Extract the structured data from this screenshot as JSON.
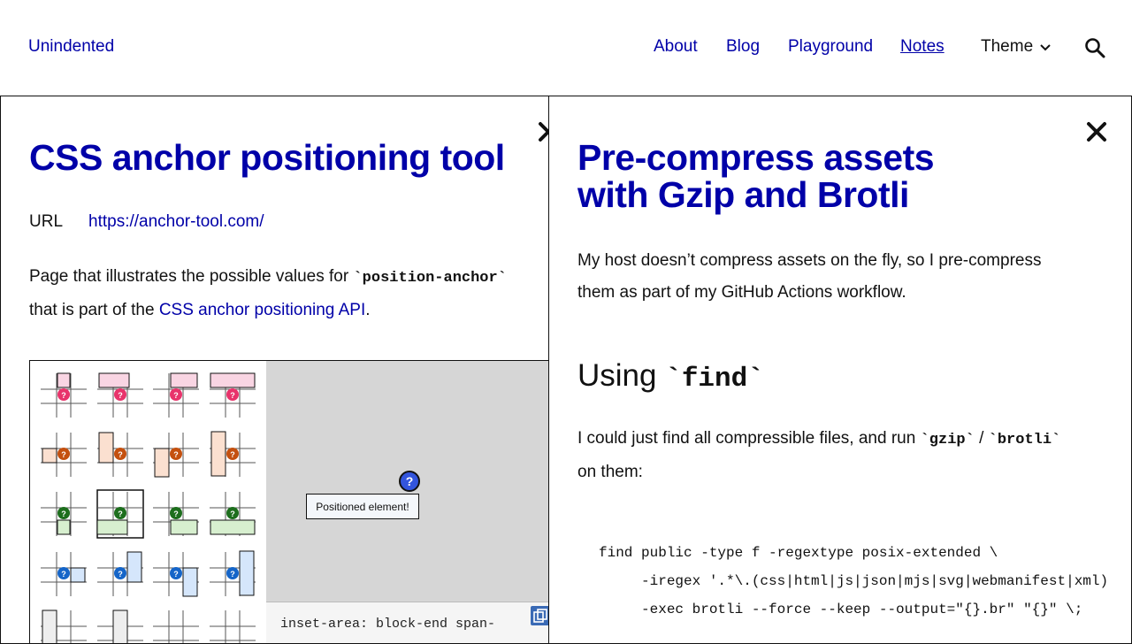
{
  "header": {
    "logo": "Unindented",
    "nav": [
      {
        "label": "About"
      },
      {
        "label": "Blog"
      },
      {
        "label": "Playground"
      },
      {
        "label": "Notes",
        "current": true
      }
    ],
    "theme_label": "Theme",
    "icons": {
      "theme_chevron": "chevron-down-icon",
      "search": "search-icon"
    }
  },
  "left_panel": {
    "title": "CSS anchor positioning tool",
    "url_key": "URL",
    "url_value": "https://anchor-tool.com/",
    "description": {
      "text_1": "Page that illustrates the possible values for ",
      "code_1": "`position-anchor`",
      "text_2": "that is part of the ",
      "link": "CSS anchor positioning API",
      "text_3": "."
    },
    "demo": {
      "positioned_label": "Positioned element!",
      "anchor_symbol": "?",
      "css_snippet": "inset-area: block-end span-"
    },
    "close_icon": "close-icon"
  },
  "right_panel": {
    "title_line_1": "Pre-compress assets",
    "title_line_2": "with Gzip and Brotli",
    "intro_line_1": "My host doesn’t compress assets on the fly, so I pre-compress",
    "intro_line_2": "them as part of my GitHub Actions workflow.",
    "section_heading_prefix": "Using ",
    "section_heading_code": "`find`",
    "body_1": "I could just find all compressible files, and run ",
    "code_gzip": "`gzip`",
    "slash": " / ",
    "code_brotli": "`brotli`",
    "body_2": "on them:",
    "code_block": "find public -type f -regextype posix-extended \\\n     -iregex '.*\\.(css|html|js|json|mjs|svg|webmanifest|xml)\n     -exec brotli --force --keep --output=\"{}.br\" \"{}\" \\;",
    "close_icon": "close-icon"
  },
  "colors": {
    "link": "#0000a8",
    "text": "#111111",
    "pink": "#e8336b",
    "orange": "#c4500f",
    "green": "#1d6e1d",
    "blue": "#1565c8",
    "stage": "#d6d6d6"
  }
}
